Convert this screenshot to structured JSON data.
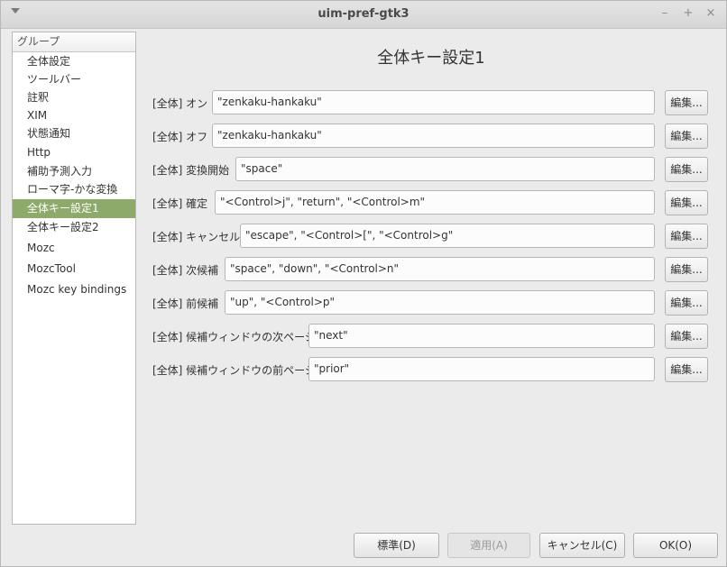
{
  "window": {
    "title": "uim-pref-gtk3",
    "minimize": "–",
    "maximize": "+",
    "close": "×"
  },
  "sidebar": {
    "header": "グループ",
    "items": [
      {
        "label": "全体設定"
      },
      {
        "label": "ツールバー"
      },
      {
        "label": "註釈"
      },
      {
        "label": "XIM"
      },
      {
        "label": "状態通知"
      },
      {
        "label": "Http"
      },
      {
        "label": "補助予測入力"
      },
      {
        "label": "ローマ字-かな変換"
      },
      {
        "label": "全体キー設定1",
        "selected": true
      },
      {
        "label": "全体キー設定2"
      },
      {
        "label": "Mozc"
      },
      {
        "label": "MozcTool"
      },
      {
        "label": "Mozc key bindings"
      }
    ]
  },
  "main": {
    "title": "全体キー設定1",
    "edit_label": "編集...",
    "rows": [
      {
        "label": "[全体] オン",
        "value": "\"zenkaku-hankaku\""
      },
      {
        "label": "[全体] オフ",
        "value": "\"zenkaku-hankaku\""
      },
      {
        "label": "[全体] 変換開始",
        "value": "\"space\""
      },
      {
        "label": "[全体] 確定",
        "value": "\"<Control>j\", \"return\", \"<Control>m\""
      },
      {
        "label": "[全体] キャンセル",
        "value": "\"escape\", \"<Control>[\", \"<Control>g\""
      },
      {
        "label": "[全体] 次候補",
        "value": "\"space\", \"down\", \"<Control>n\""
      },
      {
        "label": "[全体] 前候補",
        "value": "\"up\", \"<Control>p\""
      },
      {
        "label": "[全体] 候補ウィンドウの次ページ",
        "value": "\"next\""
      },
      {
        "label": "[全体] 候補ウィンドウの前ページ",
        "value": "\"prior\""
      }
    ]
  },
  "footer": {
    "default_label": "標準(D)",
    "apply_label": "適用(A)",
    "cancel_label": "キャンセル(C)",
    "ok_label": "OK(O)"
  }
}
